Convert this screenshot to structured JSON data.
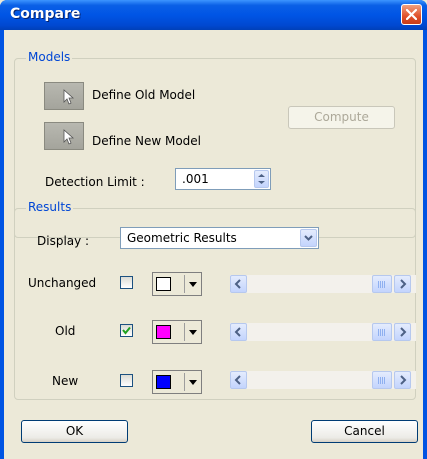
{
  "window": {
    "title": "Compare",
    "close_icon": "close-icon"
  },
  "models": {
    "legend": "Models",
    "define_old_label": "Define Old Model",
    "define_new_label": "Define New Model",
    "compute_label": "Compute",
    "detection_label": "Detection Limit :",
    "detection_value": ".001"
  },
  "results": {
    "legend": "Results",
    "display_label": "Display :",
    "display_value": "Geometric Results",
    "rows": [
      {
        "label": "Unchanged",
        "checked": false,
        "color": "#ffffff"
      },
      {
        "label": "Old",
        "checked": true,
        "color": "#ff00ff"
      },
      {
        "label": "New",
        "checked": false,
        "color": "#0000ff"
      }
    ]
  },
  "footer": {
    "ok_label": "OK",
    "cancel_label": "Cancel"
  },
  "colors": {
    "title_blue": "#0054e3",
    "legend_blue": "#0046d5",
    "dialog_bg": "#ece9d8"
  }
}
